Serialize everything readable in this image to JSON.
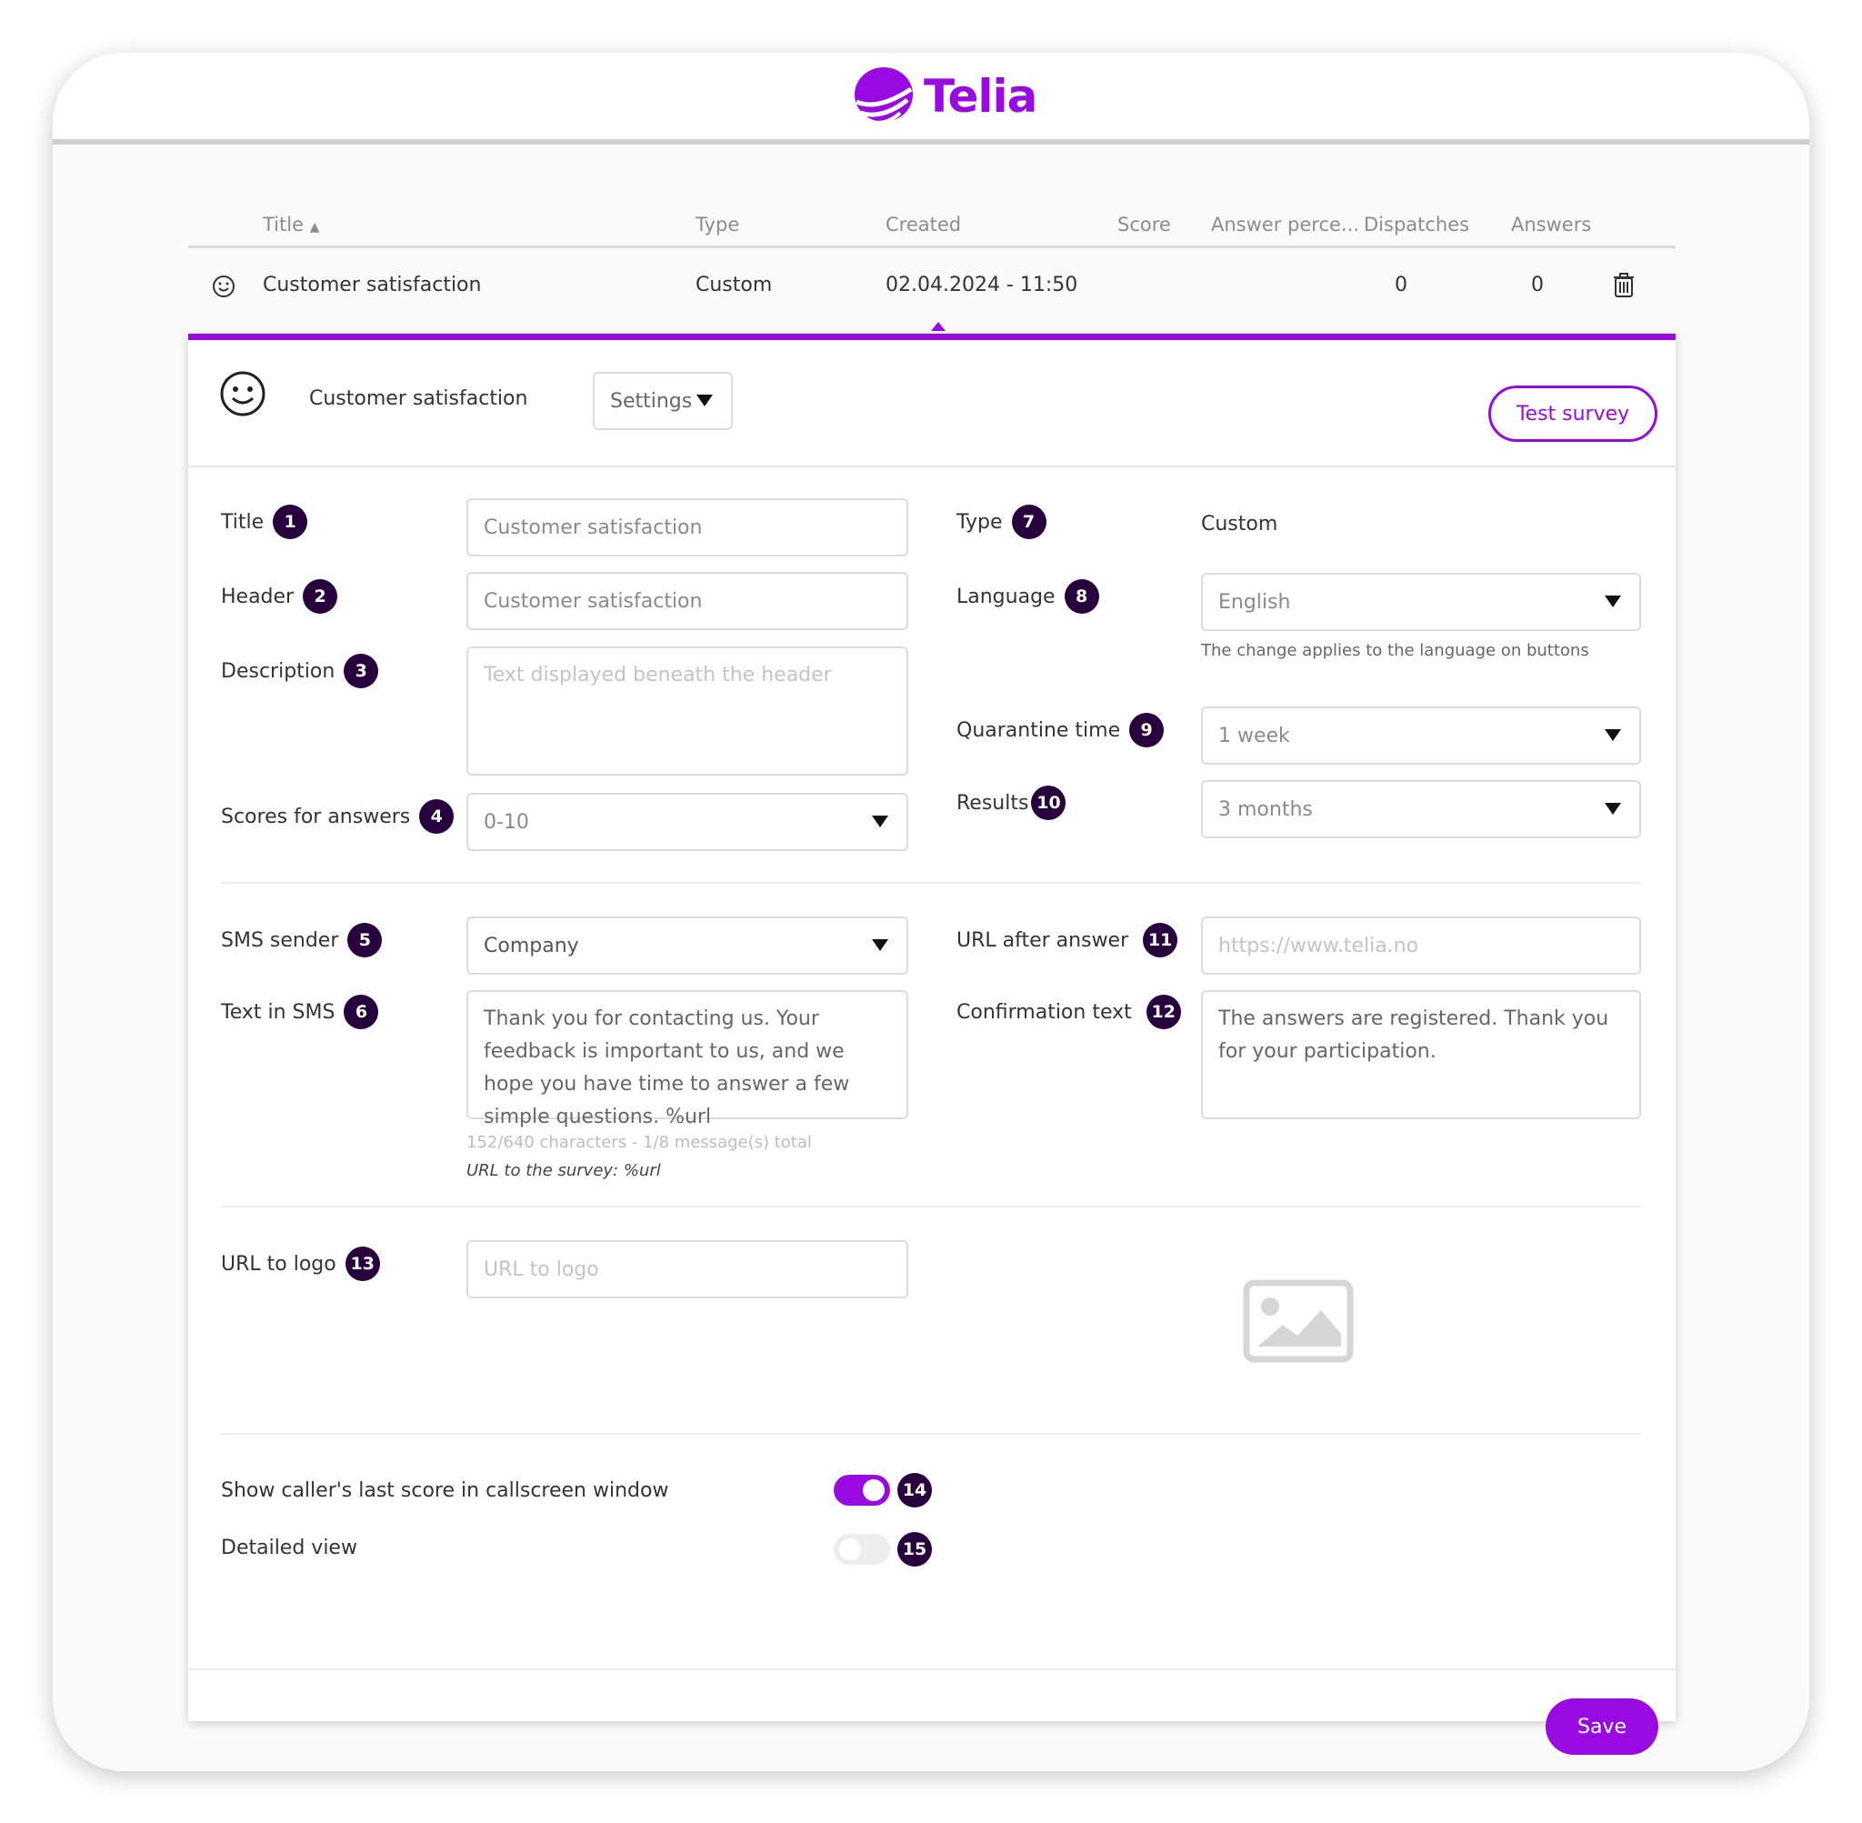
{
  "brand": {
    "name": "Telia",
    "accent": "#990ae3",
    "badge_color": "#29003e"
  },
  "table": {
    "columns": [
      "Title",
      "Type",
      "Created",
      "Score",
      "Answer perce...",
      "Dispatches",
      "Answers"
    ],
    "sort_indicator": "▲",
    "rows": [
      {
        "icon": "smiley-icon",
        "title": "Customer satisfaction",
        "type": "Custom",
        "created": "02.04.2024 - 11:50",
        "score": "",
        "answer_percent": "",
        "dispatches": "0",
        "answers": "0"
      }
    ]
  },
  "panel": {
    "survey_name": "Customer satisfaction",
    "settings_label": "Settings",
    "test_survey_label": "Test survey",
    "save_label": "Save"
  },
  "form": {
    "title": {
      "label": "Title",
      "badge": "1",
      "value": "Customer satisfaction"
    },
    "header": {
      "label": "Header",
      "badge": "2",
      "value": "Customer satisfaction"
    },
    "description": {
      "label": "Description",
      "badge": "3",
      "placeholder": "Text displayed beneath  the header"
    },
    "scores": {
      "label": "Scores for answers",
      "badge": "4",
      "value": "0-10"
    },
    "sms_sender": {
      "label": "SMS sender",
      "badge": "5",
      "value": "Company"
    },
    "text_in_sms": {
      "label": "Text in SMS",
      "badge": "6",
      "value": "Thank you for contacting us. Your feedback is important to us, and we hope you have time to answer a few simple questions. %url",
      "counter": "152/640 characters - 1/8 message(s) total",
      "hint": "URL to the survey: %url"
    },
    "type": {
      "label": "Type",
      "badge": "7",
      "value": "Custom"
    },
    "language": {
      "label": "Language",
      "badge": "8",
      "value": "English",
      "help": "The change applies to the language on buttons"
    },
    "quarantine": {
      "label": "Quarantine time",
      "badge": "9",
      "value": "1 week"
    },
    "results": {
      "label": "Results",
      "badge": "10",
      "value": "3 months"
    },
    "url_after": {
      "label": "URL after answer",
      "badge": "11",
      "placeholder": "https://www.telia.no"
    },
    "confirmation": {
      "label": "Confirmation text",
      "badge": "12",
      "value": "The answers are registered. Thank you for your participation."
    },
    "url_logo": {
      "label": "URL to logo",
      "badge": "13",
      "placeholder": "URL to logo"
    },
    "show_last_score": {
      "label": "Show caller's last score in callscreen window",
      "badge": "14",
      "on": true
    },
    "detailed_view": {
      "label": "Detailed view",
      "badge": "15",
      "on": false
    }
  }
}
